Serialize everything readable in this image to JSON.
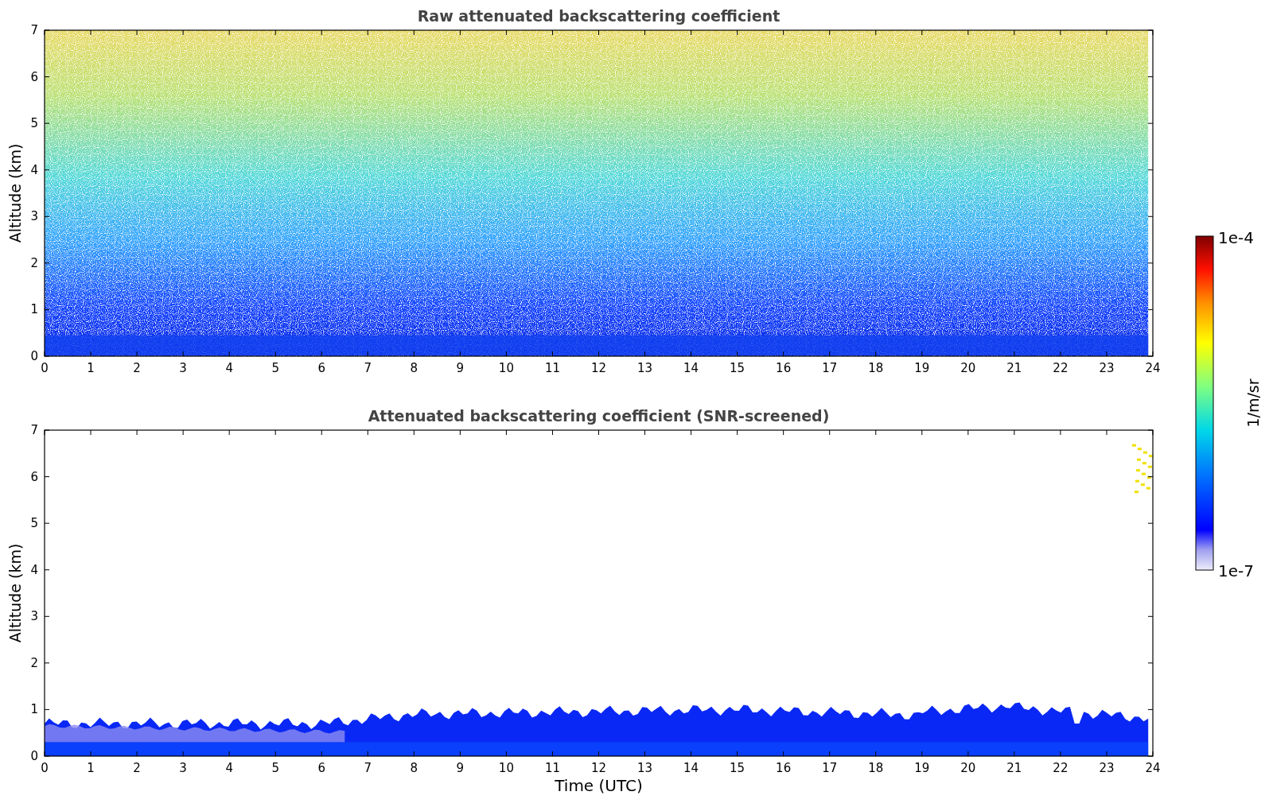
{
  "panels": [
    {
      "title": "Raw attenuated backscattering coefficient",
      "ylabel": "Altitude (km)",
      "yticks": [
        "7",
        "6",
        "5",
        "4",
        "3",
        "2",
        "1",
        "0"
      ],
      "xticks": [
        "0",
        "1",
        "2",
        "3",
        "4",
        "5",
        "6",
        "7",
        "8",
        "9",
        "10",
        "11",
        "12",
        "13",
        "14",
        "15",
        "16",
        "17",
        "18",
        "19",
        "20",
        "21",
        "22",
        "23",
        "24"
      ],
      "kind": "raw"
    },
    {
      "title": "Attenuated backscattering coefficient (SNR-screened)",
      "ylabel": "Altitude (km)",
      "yticks": [
        "7",
        "6",
        "5",
        "4",
        "3",
        "2",
        "1",
        "0"
      ],
      "xticks": [
        "0",
        "1",
        "2",
        "3",
        "4",
        "5",
        "6",
        "7",
        "8",
        "9",
        "10",
        "11",
        "12",
        "13",
        "14",
        "15",
        "16",
        "17",
        "18",
        "19",
        "20",
        "21",
        "22",
        "23",
        "24"
      ],
      "xlabel": "Time (UTC)",
      "kind": "screened"
    }
  ],
  "colorbar": {
    "max_label": "1e-4",
    "min_label": "1e-7",
    "label": "1/m/sr"
  }
}
